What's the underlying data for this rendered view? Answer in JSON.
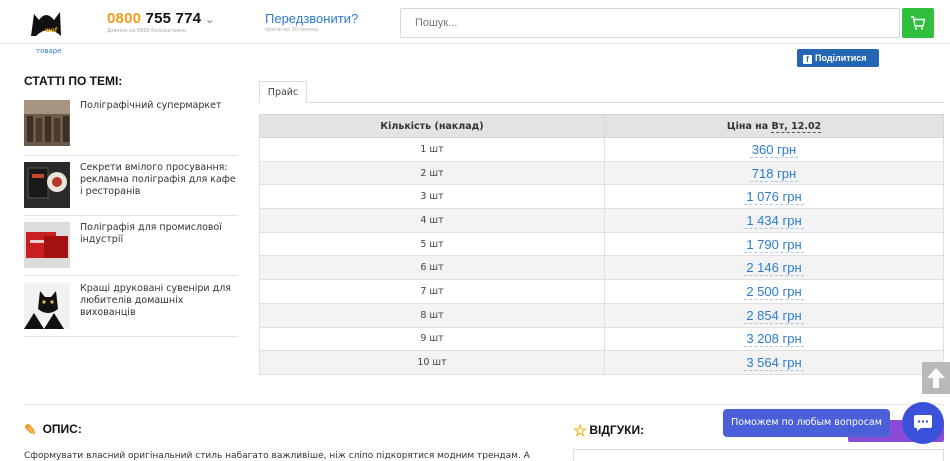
{
  "header": {
    "phone_prefix": "0800",
    "phone_number": " 755 774",
    "phone_chevron": "⌄",
    "phone_subtext": "Дзвінки на 0800 безкоштовно",
    "callback_label": "Передзвонити?",
    "callback_subtext": "протягом 30 секунд",
    "search_placeholder": "Пошук..."
  },
  "top_link": "товаре",
  "share_label": "Поділитися",
  "sidebar": {
    "title": "СТАТТІ ПО ТЕМІ:",
    "articles": [
      {
        "title": "Поліграфічний супермаркет"
      },
      {
        "title": "Секрети вмілого просування: рекламна поліграфія для кафе і ресторанів"
      },
      {
        "title": "Поліграфія для промислової індустрії"
      },
      {
        "title": "Кращі друковані сувеніри для любителів домашніх вихованців"
      }
    ]
  },
  "price": {
    "tab": "Прайс",
    "col_qty": "Кількість (наклад)",
    "col_price_prefix": "Ціна на ",
    "col_price_date": "Вт, 12.02",
    "rows": [
      {
        "qty": "1 шт",
        "price": "360 грн"
      },
      {
        "qty": "2 шт",
        "price": "718 грн"
      },
      {
        "qty": "3 шт",
        "price": "1 076 грн"
      },
      {
        "qty": "4 шт",
        "price": "1 434 грн"
      },
      {
        "qty": "5 шт",
        "price": "1 790 грн"
      },
      {
        "qty": "6 шт",
        "price": "2 146 грн"
      },
      {
        "qty": "7 шт",
        "price": "2 500 грн"
      },
      {
        "qty": "8 шт",
        "price": "2 854 грн"
      },
      {
        "qty": "9 шт",
        "price": "3 208 грн"
      },
      {
        "qty": "10 шт",
        "price": "3 564 грн"
      }
    ]
  },
  "description": {
    "title": "ОПИС:",
    "text": "Сформувати власний оригінальний стиль набагато важливіше, ніж сліпо підкорятися модним трендам. А"
  },
  "reviews": {
    "title": "ВІДГУКИ:",
    "button_label": "ать"
  },
  "chat": {
    "tooltip": "Поможем по любым вопросам"
  },
  "colors": {
    "accent_orange": "#f49c1a",
    "link_blue": "#2b7ccf",
    "cart_green": "#2fbf3c",
    "facebook_blue": "#2466b3",
    "chat_blue": "#3b51d9",
    "review_purple": "#8c4bd6"
  },
  "icons": {
    "logo": "cat-logo-icon",
    "cart": "cart-icon",
    "facebook": "facebook-icon",
    "pencil": "pencil-icon",
    "star": "star-icon",
    "scroll_up": "arrow-up-icon",
    "chat": "chat-bubble-icon"
  }
}
